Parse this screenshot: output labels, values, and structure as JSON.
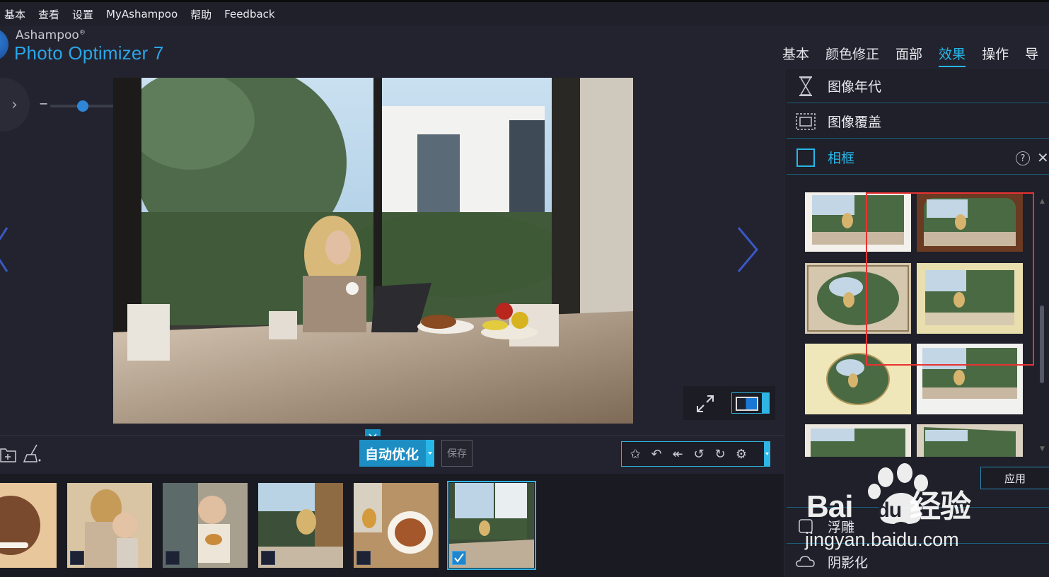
{
  "menubar": {
    "items": [
      "基本",
      "查看",
      "设置",
      "MyAshampoo",
      "帮助",
      "Feedback"
    ]
  },
  "brand": {
    "vendor": "Ashampoo",
    "product": "Photo Optimizer 7"
  },
  "tabs": [
    {
      "label": "基本",
      "active": false
    },
    {
      "label": "颜色修正",
      "active": false
    },
    {
      "label": "面部",
      "active": false
    },
    {
      "label": "效果",
      "active": true
    },
    {
      "label": "操作",
      "active": false
    },
    {
      "label": "导",
      "active": false
    }
  ],
  "zoom": {
    "minus": "−",
    "plus": "+",
    "level": 0.35
  },
  "toolbar": {
    "auto_label": "自动优化",
    "save_label": "保存"
  },
  "right_panel": {
    "effects": [
      {
        "label": "图像年代",
        "icon": "hourglass-icon"
      },
      {
        "label": "图像覆盖",
        "icon": "overlay-icon"
      },
      {
        "label": "相框",
        "icon": "frame-icon",
        "active": true
      }
    ],
    "apply_label": "应用",
    "below": [
      {
        "label": "浮雕",
        "icon": "emboss-icon"
      },
      {
        "label": "阴影化",
        "icon": "shadow-icon"
      }
    ],
    "help": "?",
    "close": "✕"
  },
  "watermark": {
    "line1": "Bai",
    "line1b": "du",
    "line1c": "经验",
    "line2": "jingyan.baidu.com"
  },
  "colors": {
    "accent": "#27b6e8",
    "panel_bg": "#1f2029",
    "app_bg": "#22232e",
    "highlight_box": "#e83232"
  },
  "filmstrip": {
    "thumbnails": [
      {
        "checked": null
      },
      {
        "checked": false
      },
      {
        "checked": false
      },
      {
        "checked": false
      },
      {
        "checked": false
      },
      {
        "checked": true,
        "selected": true
      }
    ]
  }
}
